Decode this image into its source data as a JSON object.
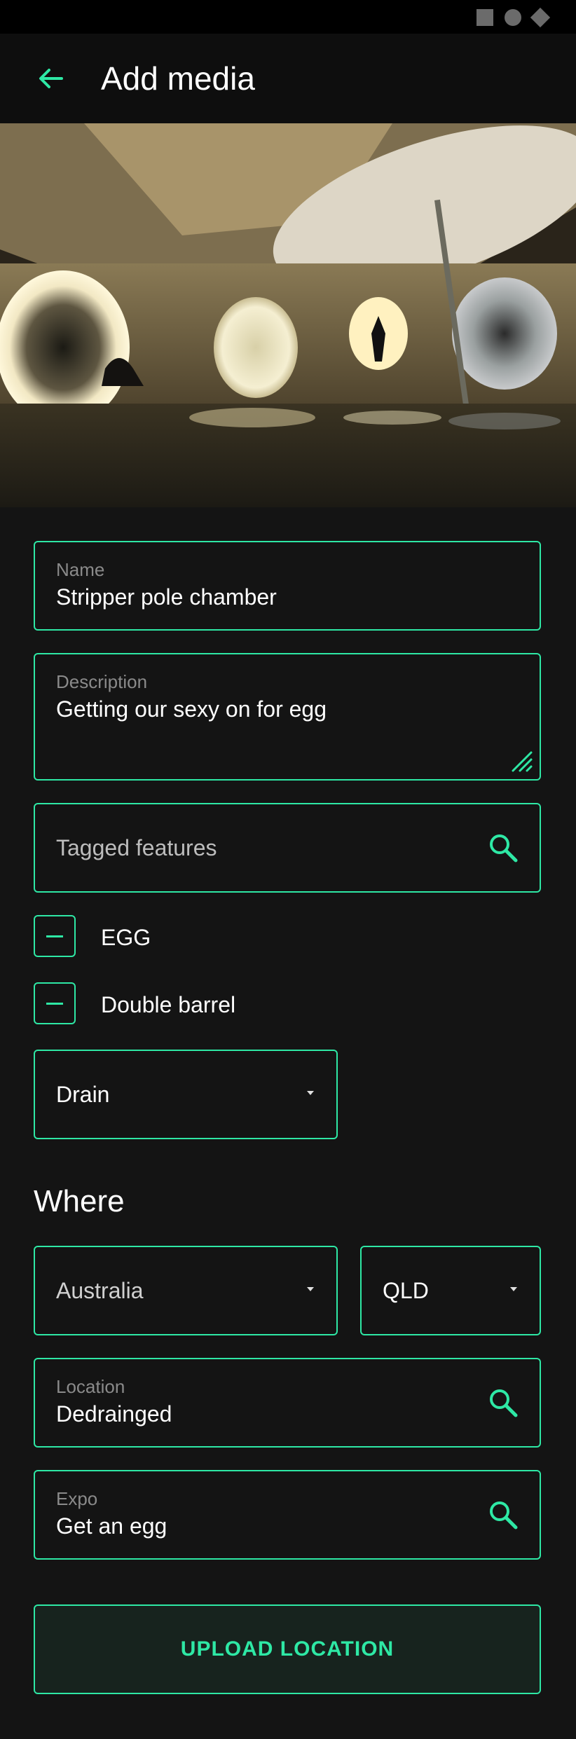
{
  "header": {
    "title": "Add media",
    "back_icon": "arrow-back-icon"
  },
  "media": {
    "alt": "Drain chamber photo"
  },
  "form": {
    "name": {
      "label": "Name",
      "value": "Stripper pole chamber"
    },
    "description": {
      "label": "Description",
      "value": "Getting our sexy on for egg"
    },
    "tagged_features": {
      "placeholder": "Tagged features"
    },
    "tags": [
      {
        "label": "EGG"
      },
      {
        "label": "Double barrel"
      }
    ],
    "type_select": {
      "value": "Drain"
    }
  },
  "where": {
    "title": "Where",
    "country": {
      "value": "Australia"
    },
    "state": {
      "value": "QLD"
    },
    "location": {
      "label": "Location",
      "value": "Dedrainged"
    },
    "expo": {
      "label": "Expo",
      "value": "Get an egg"
    }
  },
  "actions": {
    "upload_label": "UPLOAD LOCATION"
  },
  "colors": {
    "accent": "#2ee8a5",
    "background": "#141414",
    "appbar": "#0e0e0e"
  }
}
